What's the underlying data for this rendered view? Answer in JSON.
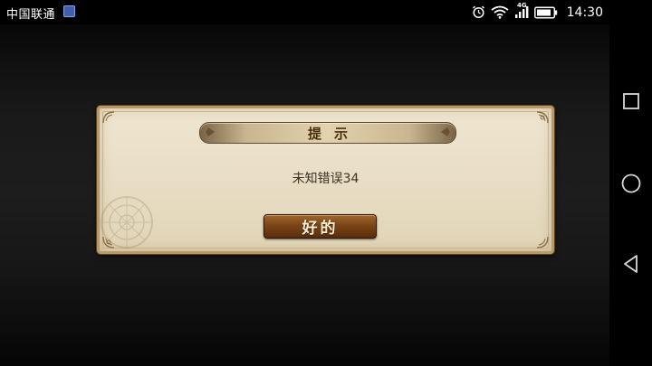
{
  "status_bar": {
    "carrier": "中国联通",
    "network_label": "4G",
    "time": "14:30",
    "icons": [
      "app-notification-icon",
      "alarm-icon",
      "wifi-icon",
      "signal-icon",
      "battery-icon"
    ]
  },
  "dialog": {
    "title": "提示",
    "message": "未知错误34",
    "ok_label": "好的"
  },
  "nav_bar": {
    "icons": [
      "recent-apps-icon",
      "home-icon",
      "back-icon"
    ]
  },
  "colors": {
    "dialog_bg": "#e7dcc2",
    "dialog_border": "#b89866",
    "button_bg": "#7b4417",
    "button_text": "#fdf0d2",
    "title_text": "#4a2e12"
  }
}
